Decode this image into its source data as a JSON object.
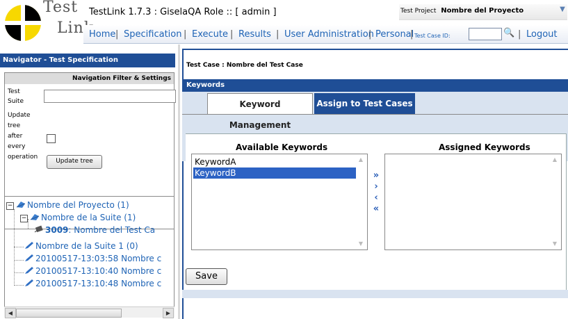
{
  "header": {
    "logo_word1": "Test",
    "logo_word2": "Link",
    "app_title": "TestLink 1.7.3 : GiselaQA Role :: [ admin ]",
    "project_label": "Test Project",
    "project_value": "Nombre del Proyecto"
  },
  "menu": {
    "home": "Home",
    "specification": "Specification",
    "execute": "Execute",
    "results": "Results",
    "user_admin": "User Administration",
    "personal": "Personal",
    "tcid_label": "Test Case ID:",
    "logout": "Logout",
    "separator": "|"
  },
  "navigator": {
    "title": "Navigator - Test Specification",
    "filter_title": "Navigation Filter & Settings",
    "suite_label_1": "Test",
    "suite_label_2": "Suite",
    "update_label_1": "Update",
    "update_label_2": "tree",
    "update_label_3": "after",
    "update_label_4": "every",
    "update_label_5": "operation",
    "update_button": "Update tree"
  },
  "tree": {
    "project": "Nombre del Proyecto (1)",
    "suite": "Nombre de la Suite (1)",
    "case_id": "3009",
    "case_name": ": Nombre del Test Ca",
    "suite1": "Nombre de la Suite 1 (0)",
    "item1": "20100517-13:03:58 Nombre c",
    "item2": "20100517-13:10:40 Nombre c",
    "item3": "20100517-13:10:48 Nombre c"
  },
  "main": {
    "tc_title": "Test Case : Nombre del Test Case",
    "keywords_bar": "Keywords",
    "tab_management": "Keyword Management",
    "tab_assign": "Assign to Test Cases",
    "available_title": "Available Keywords",
    "assigned_title": "Assigned Keywords",
    "available": [
      "KeywordA",
      "KeywordB"
    ],
    "selected_available": "KeywordB",
    "save": "Save"
  },
  "colors": {
    "nav_blue": "#1f4e96",
    "link_blue": "#1e63b5",
    "selection": "#2c62c4"
  }
}
